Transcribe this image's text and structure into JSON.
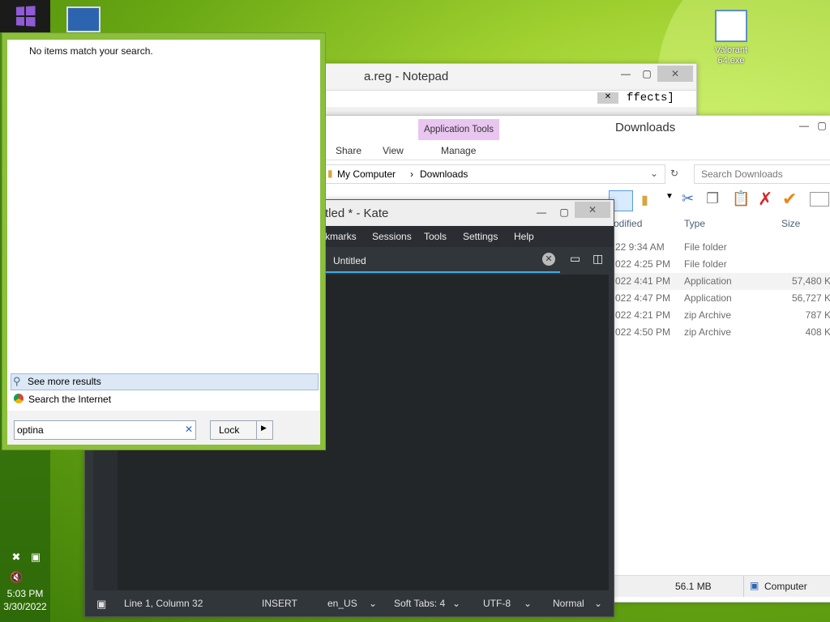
{
  "desktop": {
    "icons": [
      {
        "label": "Valorant\n64.exe"
      }
    ]
  },
  "taskbar": {
    "time": "5:03 PM",
    "date": "3/30/2022"
  },
  "notepad": {
    "title": "a.reg - Notepad",
    "visible_text": "ffects]"
  },
  "explorer": {
    "title": "Downloads",
    "context_tab": "Application Tools",
    "ribbon_tabs": [
      "Share",
      "View",
      "Manage"
    ],
    "breadcrumb": [
      "My Computer",
      "Downloads"
    ],
    "search_placeholder": "Search Downloads",
    "columns": [
      "odified",
      "Type",
      "Size"
    ],
    "rows": [
      {
        "modified": "22 9:34 AM",
        "type": "File folder",
        "size": ""
      },
      {
        "modified": "022 4:25 PM",
        "type": "File folder",
        "size": ""
      },
      {
        "modified": "022 4:41 PM",
        "type": "Application",
        "size": "57,480 K"
      },
      {
        "modified": "022 4:47 PM",
        "type": "Application",
        "size": "56,727 K"
      },
      {
        "modified": "022 4:21 PM",
        "type": "zip Archive",
        "size": "787 K"
      },
      {
        "modified": "022 4:50 PM",
        "type": "zip Archive",
        "size": "408 K"
      }
    ],
    "status_size": "56.1 MB",
    "status_location": "Computer"
  },
  "kate": {
    "title": "tled * - Kate",
    "menu": [
      "kmarks",
      "Sessions",
      "Tools",
      "Settings",
      "Help"
    ],
    "tab_label": "Untitled",
    "status": {
      "position": "Line 1, Column 32",
      "mode": "INSERT",
      "language": "en_US",
      "tabs": "Soft Tabs: 4",
      "encoding": "UTF-8",
      "input_mode": "Normal"
    }
  },
  "search_popup": {
    "no_results": "No items match your search.",
    "see_more": "See more results",
    "search_internet": "Search the Internet",
    "query": "optina",
    "lock_label": "Lock"
  }
}
